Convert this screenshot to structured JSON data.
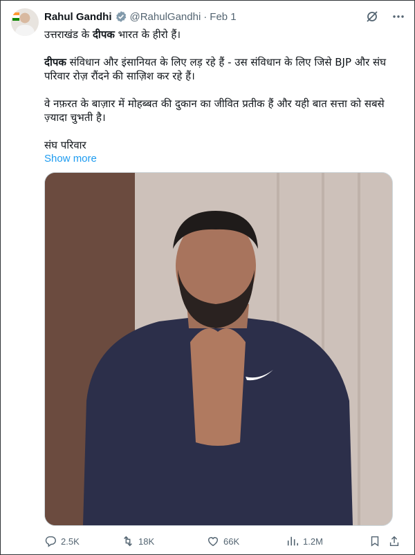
{
  "tweet": {
    "author_name": "Rahul Gandhi",
    "handle": "@RahulGandhi",
    "separator": "·",
    "date": "Feb 1",
    "line1_pre": "उत्तराखंड के ",
    "line1_bold": "दीपक",
    "line1_post": " भारत के हीरो हैं।",
    "para2_bold": "दीपक",
    "para2_text": " संविधान और इंसानियत के लिए लड़ रहे हैं - उस संविधान के लिए जिसे BJP और संघ परिवार रोज़ रौंदने की साज़िश कर रहे हैं।",
    "para3_text": "वे नफ़रत के बाज़ार में मोहब्बत की दुकान का जीवित प्रतीक हैं और यही बात सत्ता को सबसे ज़्यादा चुभती है।",
    "para4_text": "संघ परिवार",
    "show_more": "Show more"
  },
  "icons": {
    "verified": "verified-badge-icon",
    "grok": "grok-icon",
    "more": "more-icon",
    "reply": "reply-icon",
    "retweet": "retweet-icon",
    "like": "like-icon",
    "views": "views-icon",
    "bookmark": "bookmark-icon",
    "share": "share-icon"
  },
  "stats": {
    "replies": "2.5K",
    "retweets": "18K",
    "likes": "66K",
    "views": "1.2M"
  },
  "colors": {
    "link": "#1d9bf0",
    "secondary_text": "#536471",
    "verified_badge": "#829aab"
  }
}
